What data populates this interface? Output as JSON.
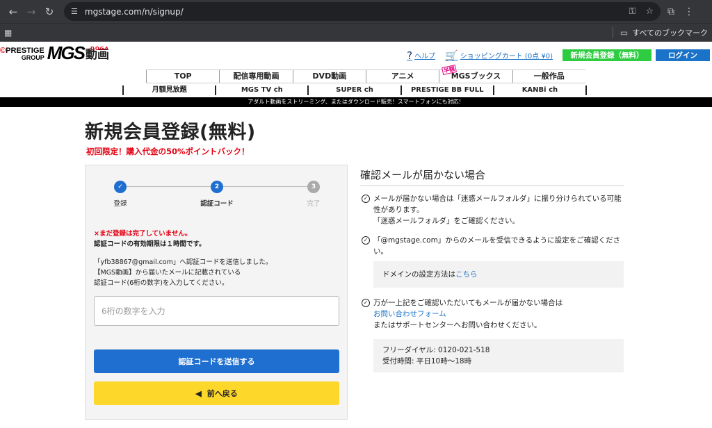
{
  "browser": {
    "url": "mgstage.com/n/signup/",
    "bookmarks_label": "すべてのブックマーク"
  },
  "header": {
    "logo_prestige_line1": "PRESTIGE",
    "logo_prestige_line2": "GROUP",
    "logo_mgs": "MGS",
    "logo_douga": "動画",
    "logo_douga_en": "DOGA",
    "help_label": "ヘルプ",
    "cart_label": "ショッピングカート (0点 ¥0)",
    "signup_label": "新規会員登録（無料）",
    "login_label": "ログイン"
  },
  "main_nav": [
    {
      "label": "TOP"
    },
    {
      "label": "配信専用動画"
    },
    {
      "label": "DVD動画"
    },
    {
      "label": "アニメ"
    },
    {
      "label": "MGSブックス",
      "badge": "半額"
    },
    {
      "label": "一般作品"
    }
  ],
  "sub_nav": [
    {
      "label": "月額見放題"
    },
    {
      "label": "MGS TV ch"
    },
    {
      "label": "SUPER ch"
    },
    {
      "label": "PRESTIGE BB FULL"
    },
    {
      "label": "KANBi ch"
    }
  ],
  "notice_bar": "アダルト動画をストリーミング、またはダウンロード販売！スマートフォンにも対応！",
  "page": {
    "title": "新規会員登録(無料)",
    "promo": "初回限定！購入代金の50%ポイントバック！"
  },
  "steps": [
    {
      "label": "登録",
      "state": "done",
      "marker": "✓"
    },
    {
      "label": "認証コード",
      "state": "active",
      "marker": "2"
    },
    {
      "label": "完了",
      "state": "pending",
      "marker": "3"
    }
  ],
  "form": {
    "warning": "×まだ登録は完了していません。",
    "expiry": "認証コードの有効期限は１時間です。",
    "sent_line1": "「yfb38867@gmail.com」へ認証コードを送信しました。",
    "sent_line2": "【MGS動画】から届いたメールに記載されている",
    "sent_line3": "認証コード(6桁の数字)を入力してください。",
    "code_value": "",
    "code_placeholder": "6桁の数字を入力",
    "send_label": "認証コードを送信する",
    "back_label": "前へ戻る"
  },
  "help": {
    "title": "確認メールが届かない場合",
    "item1_line1": "メールが届かない場合は「迷惑メールフォルダ」に振り分けられている可能",
    "item1_line2": "性があります。",
    "item1_line3": "「迷惑メールフォルダ」をご確認ください。",
    "item2_line1": "「@mgstage.com」からのメールを受信できるように設定をご確認くださ",
    "item2_line2": "い。",
    "domain_text": "ドメインの設定方法は",
    "domain_link": "こちら",
    "item3_line1": "万が一上記をご確認いただいてもメールが届かない場合は",
    "item3_link": "お問い合わせフォーム",
    "item3_line3": "またはサポートセンターへお問い合わせください。",
    "freedial": "フリーダイヤル: 0120-021-518",
    "hours": "受付時間: 平日10時〜18時"
  },
  "colors": {
    "accent_blue": "#1f6fd0",
    "signup_green": "#2ecc40",
    "warning_red": "#e60012",
    "back_yellow": "#fdd72a"
  }
}
